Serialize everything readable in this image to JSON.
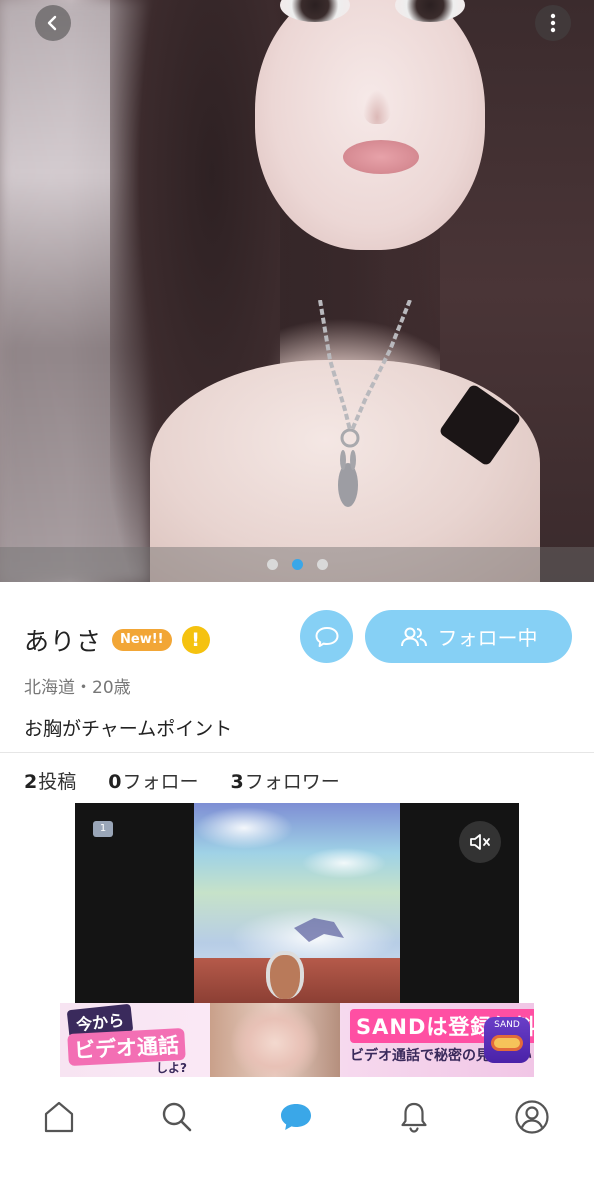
{
  "profile": {
    "name": "ありさ",
    "badge": "New!!",
    "warning_symbol": "!",
    "location_age": "北海道・20歳",
    "bio": "お胸がチャームポイント",
    "follow_label": "フォロー中",
    "stats": [
      {
        "count": "2",
        "label": "投稿"
      },
      {
        "count": "0",
        "label": "フォロー"
      },
      {
        "count": "3",
        "label": "フォロワー"
      }
    ]
  },
  "carousel": {
    "current": 2,
    "total": 3
  },
  "ad": {
    "video_badge": "1",
    "banner": {
      "line1": "今から",
      "line2": "ビデオ通話",
      "line3": "しよ?",
      "headline": "SANDは登録無料",
      "subline": "ビデオ通話で秘密の見せ合い",
      "logo_text": "SAND"
    }
  },
  "nav": {
    "items": [
      "home-icon",
      "search-icon",
      "chat-icon",
      "bell-icon",
      "profile-icon"
    ],
    "active": "chat-icon"
  },
  "colors": {
    "accent": "#3aa7e8",
    "button_fill": "#86d0f5",
    "badge_orange": "#f2a636",
    "warning_yellow": "#f5c20f"
  }
}
